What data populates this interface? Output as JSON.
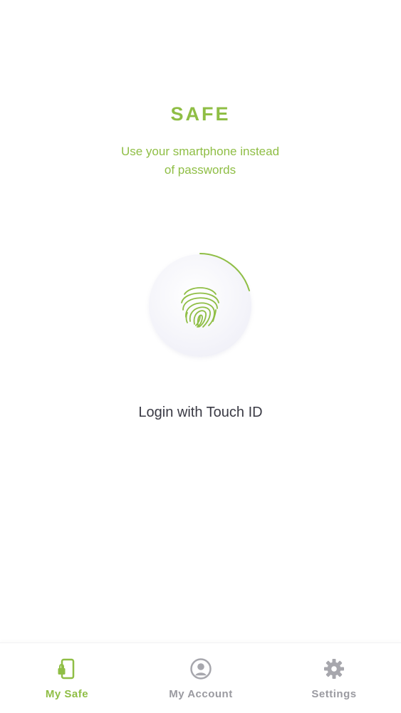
{
  "app": {
    "title": "SAFE",
    "subtitle_line1": "Use your smartphone instead",
    "subtitle_line2": "of passwords"
  },
  "auth": {
    "login_label": "Login with Touch ID",
    "icon": "fingerprint-icon"
  },
  "tabbar": {
    "tabs": [
      {
        "label": "My Safe",
        "icon": "phone-lock-icon",
        "active": true
      },
      {
        "label": "My Account",
        "icon": "user-circle-icon",
        "active": false
      },
      {
        "label": "Settings",
        "icon": "gear-icon",
        "active": false
      }
    ]
  },
  "colors": {
    "accent": "#8fbe45",
    "text": "#3a3a44",
    "inactive": "#9a9aa0"
  }
}
